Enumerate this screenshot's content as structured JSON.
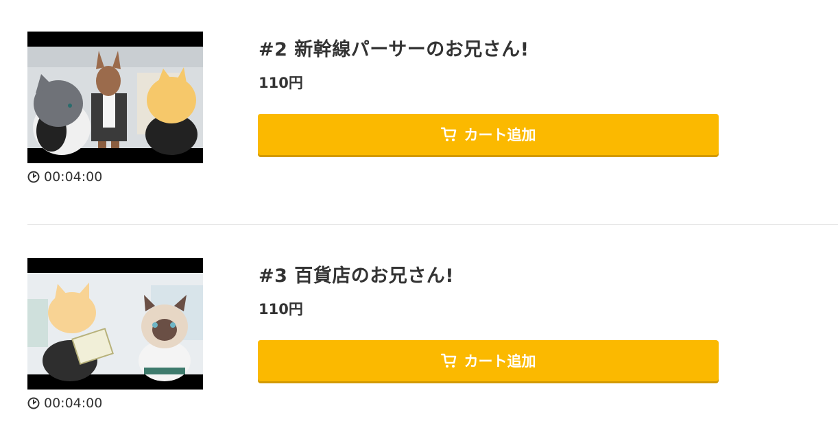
{
  "episodes": [
    {
      "title": "#2 新幹線パーサーのお兄さん!",
      "price": "110円",
      "duration": "00:04:00",
      "cart_label": "カート追加"
    },
    {
      "title": "#3 百貨店のお兄さん!",
      "price": "110円",
      "duration": "00:04:00",
      "cart_label": "カート追加"
    }
  ],
  "colors": {
    "cart_button": "#fbb900",
    "cart_button_shadow": "#d39a00",
    "text": "#333333",
    "divider": "#e6e6e6"
  },
  "icons": {
    "duration": "clock-icon",
    "cart": "cart-icon"
  }
}
